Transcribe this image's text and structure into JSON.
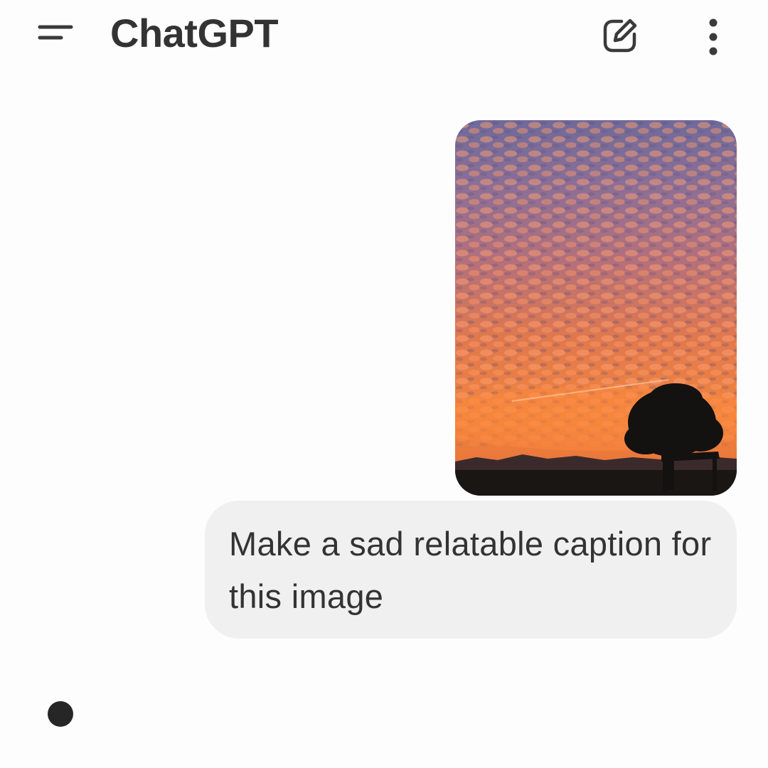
{
  "header": {
    "title": "ChatGPT",
    "menu_icon": "hamburger-menu-icon",
    "new_chat_icon": "edit-pencil-icon",
    "more_icon": "vertical-ellipsis-icon"
  },
  "conversation": {
    "user_message": {
      "attachment": {
        "type": "image",
        "description_icon": "sunset-photo"
      },
      "text": "Make a sad relatable caption for this image"
    },
    "assistant": {
      "state": "thinking"
    }
  },
  "colors": {
    "background": "#fdfdfd",
    "bubble": "#f0f0f0",
    "text": "#333333",
    "icon": "#3a3a3a",
    "typing_dot": "#262626"
  }
}
